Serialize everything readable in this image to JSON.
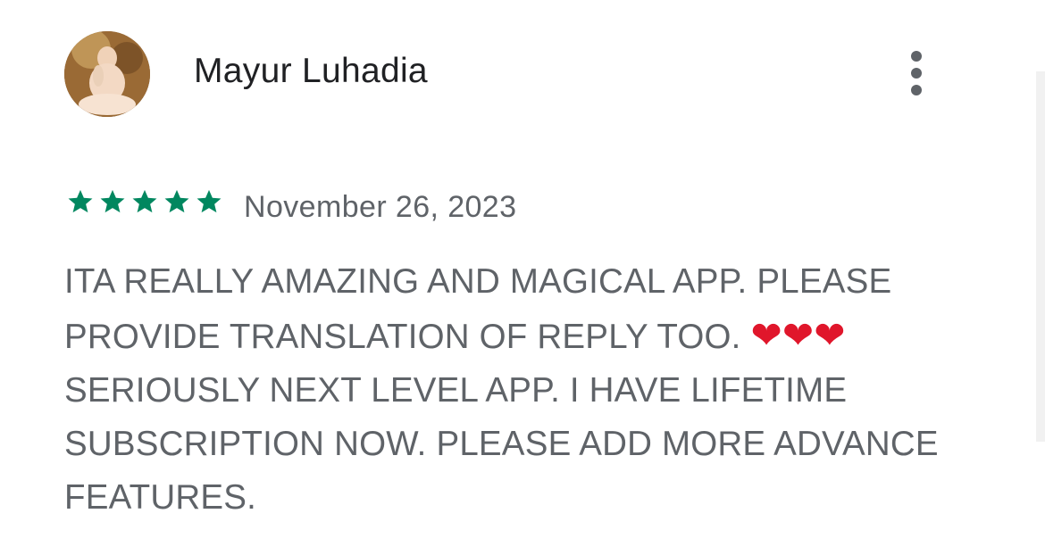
{
  "review": {
    "author": {
      "name": "Mayur Luhadia"
    },
    "rating": {
      "value": 5,
      "max": 5,
      "star_color": "#01875f"
    },
    "date": "November 26, 2023",
    "text_part1": "ITA REALLY AMAZING AND MAGICAL APP. PLEASE PROVIDE TRANSLATION OF REPLY TOO. ",
    "hearts": "❤❤❤",
    "text_part2": " SERIOUSLY NEXT LEVEL APP. I HAVE LIFETIME SUBSCRIPTION NOW. PLEASE ADD MORE ADVANCE FEATURES.",
    "more_icon": "more-vert-icon"
  }
}
